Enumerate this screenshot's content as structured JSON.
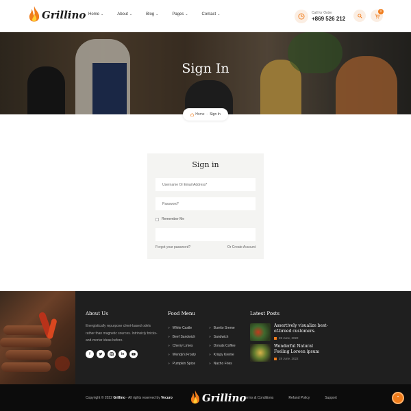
{
  "brand": {
    "name": "Grillino",
    "accent": "#f07c1b"
  },
  "nav": {
    "items": [
      {
        "label": "Home"
      },
      {
        "label": "About"
      },
      {
        "label": "Blog"
      },
      {
        "label": "Pages"
      },
      {
        "label": "Contact"
      }
    ]
  },
  "call": {
    "label": "Call for Order",
    "number": "+869 526 212"
  },
  "cart": {
    "count": "0"
  },
  "hero": {
    "title": "Sign In"
  },
  "breadcrumb": {
    "home": "Home",
    "sep": "-",
    "current": "Sign In"
  },
  "form": {
    "title": "Sign in",
    "username_placeholder": "Username Or Email Address*",
    "password_placeholder": "Password*",
    "remember_label": "Remember Me",
    "forgot_label": "Forgot your password?",
    "create_label": "Or Create Account"
  },
  "footer": {
    "about": {
      "title": "About Us",
      "text": "Energistically repurpose client-based odels rather than magnetic sources. Intrinsicly bricks-and-mortar ideas before."
    },
    "socials": [
      "f",
      "t",
      "ig",
      "in",
      "yt"
    ],
    "menu": {
      "title": "Food Menu",
      "col1": [
        "White Castle",
        "Beef Sandwich",
        "Cherry Limes",
        "Wendy's Frosty",
        "Pumpkin Spice"
      ],
      "col2": [
        "Burrito Sreme",
        "Sandwich",
        "Donuts Coffee",
        "Krispy Kreme",
        "Nacho Fries"
      ]
    },
    "posts": {
      "title": "Latest Posts",
      "items": [
        {
          "title": "Assertively visualize best-of-breed customers.",
          "date": "28 June, 2022"
        },
        {
          "title": "Wonderful Natural Feeling Loreen ipsum",
          "date": "28 June, 2022"
        }
      ]
    }
  },
  "bottom": {
    "copyright_prefix": "Copyright © 2022",
    "copyright_brand": "Grillino",
    "copyright_mid": "- All rights reserved by",
    "copyright_by": "Vecuro",
    "links": [
      "Terms & Conditions",
      "Refund Policy",
      "Support"
    ]
  }
}
